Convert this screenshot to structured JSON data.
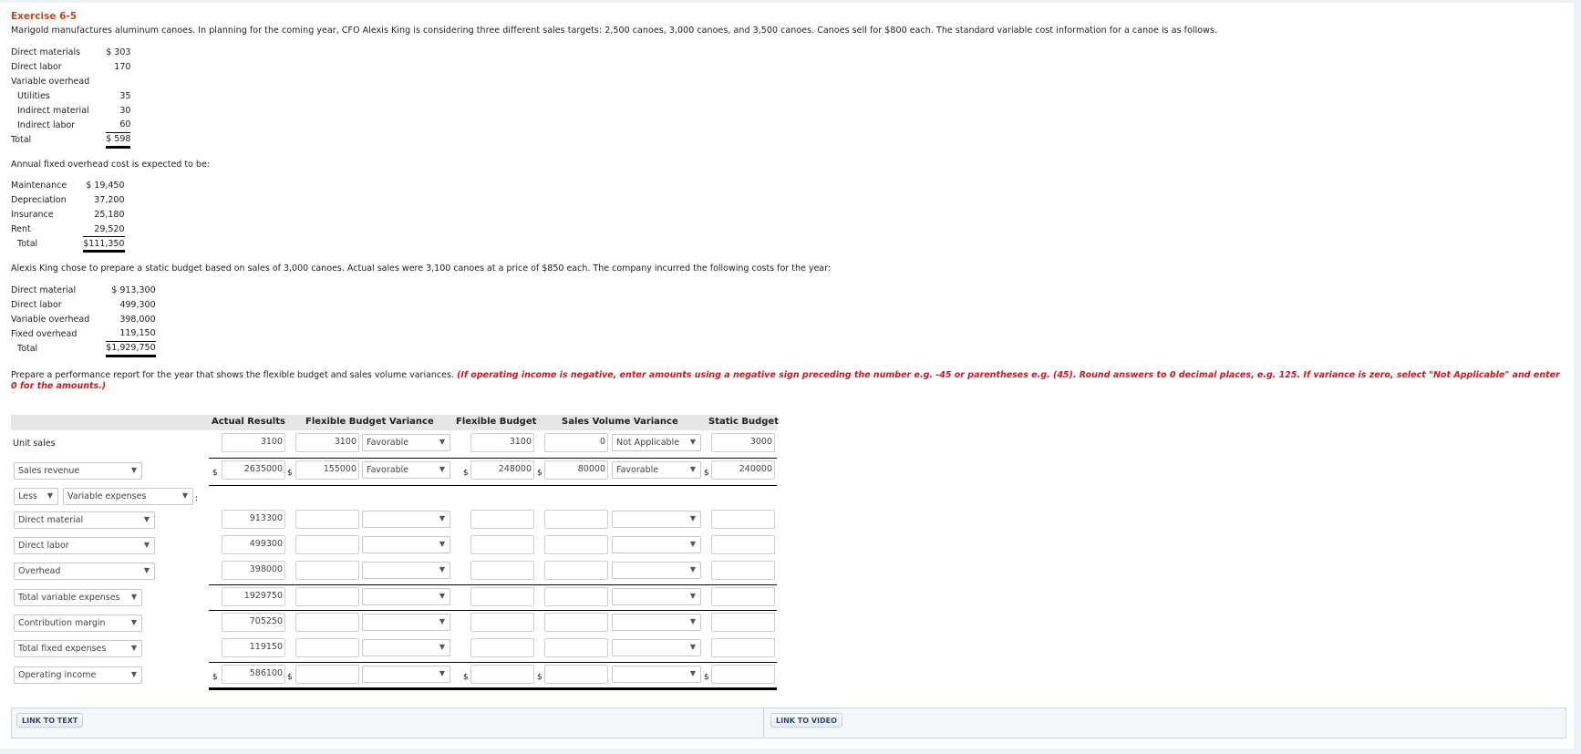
{
  "title": "Exercise 6-5",
  "intro": "Marigold manufactures aluminum canoes. In planning for the coming year, CFO Alexis King is considering three different sales targets: 2,500 canoes, 3,000 canoes, and 3,500 canoes. Canoes sell for $800 each. The standard variable cost information for a canoe is as follows.",
  "variable_costs": [
    {
      "label": "Direct materials",
      "amount": "$ 303",
      "indent": false
    },
    {
      "label": "Direct labor",
      "amount": "170",
      "indent": false
    },
    {
      "label": "Variable overhead",
      "amount": "",
      "indent": false
    },
    {
      "label": "Utilities",
      "amount": "35",
      "indent": true
    },
    {
      "label": "Indirect material",
      "amount": "30",
      "indent": true
    },
    {
      "label": "Indirect labor",
      "amount": "60",
      "indent": true
    },
    {
      "label": "Total",
      "amount": "$ 598",
      "indent": false
    }
  ],
  "fixed_intro": "Annual fixed overhead cost is expected to be:",
  "fixed_costs": [
    {
      "label": "Maintenance",
      "amount": "$ 19,450"
    },
    {
      "label": "Depreciation",
      "amount": "37,200"
    },
    {
      "label": "Insurance",
      "amount": "25,180"
    },
    {
      "label": "Rent",
      "amount": "29,520"
    },
    {
      "label": "Total",
      "amount": "$111,350"
    }
  ],
  "actual_intro": "Alexis King chose to prepare a static budget based on sales of 3,000 canoes. Actual sales were 3,100 canoes at a price of $850 each. The company incurred the following costs for the year:",
  "actual_costs": [
    {
      "label": "Direct material",
      "amount": "$ 913,300"
    },
    {
      "label": "Direct labor",
      "amount": "499,300"
    },
    {
      "label": "Variable overhead",
      "amount": "398,000"
    },
    {
      "label": "Fixed overhead",
      "amount": "119,150"
    },
    {
      "label": "Total",
      "amount": "$1,929,750"
    }
  ],
  "instructions": {
    "plain": "Prepare a performance report for the year that shows the flexible budget and sales volume variances. ",
    "red": "(If operating income is negative, enter amounts using a negative sign preceding the number e.g. -45 or parentheses e.g. (45). Round answers to 0 decimal places, e.g. 125. If variance is zero, select \"Not Applicable\" and enter 0 for the amounts.)"
  },
  "report": {
    "headers": [
      "Actual Results",
      "Flexible Budget Variance",
      "Flexible Budget",
      "Sales Volume Variance",
      "Static Budget"
    ],
    "unit_sales": {
      "label": "Unit sales",
      "actual": "3100",
      "fb_variance": "3100",
      "fb_variance_type": "Favorable",
      "flexible": "3100",
      "sv_variance": "0",
      "sv_variance_type": "Not Applicable",
      "static": "3000"
    },
    "sales_revenue": {
      "label": "Sales revenue",
      "actual": "2635000",
      "fb_variance": "155000",
      "fb_variance_type": "Favorable",
      "flexible": "248000",
      "sv_variance": "80000",
      "sv_variance_type": "Favorable",
      "static": "240000"
    },
    "less_label": "Less",
    "less_item": "Variable expenses",
    "colon": ":",
    "rows": [
      {
        "label": "Direct material",
        "actual": "913300"
      },
      {
        "label": "Direct labor",
        "actual": "499300"
      },
      {
        "label": "Overhead",
        "actual": "398000"
      },
      {
        "label": "Total variable expenses",
        "actual": "1929750"
      },
      {
        "label": "Contribution margin",
        "actual": "705250"
      },
      {
        "label": "Total fixed expenses",
        "actual": "119150"
      },
      {
        "label": "Operating income",
        "actual": "586100"
      }
    ],
    "currency": "$",
    "dropdown_arrow": "▼"
  },
  "footer": {
    "link_text": "LINK TO TEXT",
    "link_video": "LINK TO VIDEO"
  }
}
